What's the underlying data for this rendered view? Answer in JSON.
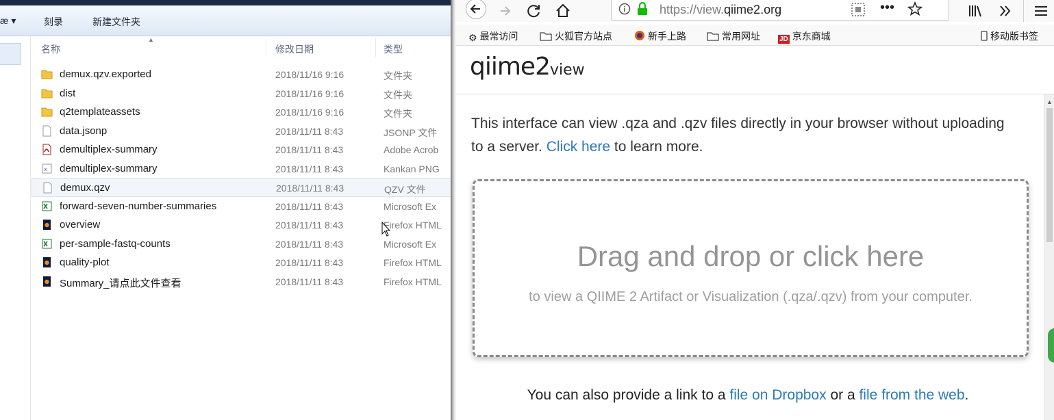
{
  "explorer": {
    "toolbar": {
      "organize": "æ ▾",
      "burn": "刻录",
      "new_folder": "新建文件夹"
    },
    "columns": {
      "name": "名称",
      "date": "修改日期",
      "type": "类型"
    },
    "files": [
      {
        "name": "demux.qzv.exported",
        "date": "2018/11/16 9:16",
        "type": "文件夹",
        "icon": "folder-icon"
      },
      {
        "name": "dist",
        "date": "2018/11/16 9:16",
        "type": "文件夹",
        "icon": "folder-icon"
      },
      {
        "name": "q2templateassets",
        "date": "2018/11/16 9:16",
        "type": "文件夹",
        "icon": "folder-icon"
      },
      {
        "name": "data.jsonp",
        "date": "2018/11/11 8:43",
        "type": "JSONP 文件",
        "icon": "document-icon"
      },
      {
        "name": "demultiplex-summary",
        "date": "2018/11/11 8:43",
        "type": "Adobe Acrob",
        "icon": "pdf-icon"
      },
      {
        "name": "demultiplex-summary",
        "date": "2018/11/11 8:43",
        "type": "Kankan PNG",
        "icon": "png-icon"
      },
      {
        "name": "demux.qzv",
        "date": "2018/11/11 8:43",
        "type": "QZV 文件",
        "icon": "document-icon"
      },
      {
        "name": "forward-seven-number-summaries",
        "date": "2018/11/11 8:43",
        "type": "Microsoft Ex",
        "icon": "excel-icon"
      },
      {
        "name": "overview",
        "date": "2018/11/11 8:43",
        "type": "Firefox HTML",
        "icon": "html-icon"
      },
      {
        "name": "per-sample-fastq-counts",
        "date": "2018/11/11 8:43",
        "type": "Microsoft Ex",
        "icon": "excel-icon"
      },
      {
        "name": "quality-plot",
        "date": "2018/11/11 8:43",
        "type": "Firefox HTML",
        "icon": "html-icon"
      },
      {
        "name": "Summary_请点此文件查看",
        "date": "2018/11/11 8:43",
        "type": "Firefox HTML",
        "icon": "html-icon"
      }
    ]
  },
  "browser": {
    "url_prefix": "https://view.",
    "url_domain": "qiime2.org",
    "bookmarks": [
      "最常访问",
      "火狐官方站点",
      "新手上路",
      "常用网址",
      "京东商城",
      "移动版书签"
    ],
    "logo": {
      "main": "qiime2",
      "sub": "view"
    },
    "intro_before": "This interface can view .qza and .qzv files directly in your browser without uploading to a server. ",
    "intro_link": "Click here",
    "intro_after": " to learn more.",
    "dropzone_title": "Drag and drop or click here",
    "dropzone_sub": "to view a QIIME 2 Artifact or Visualization (.qza/.qzv) from your computer.",
    "alt_before": "You can also provide a link to a ",
    "alt_link1": "file on Dropbox",
    "alt_mid": " or a ",
    "alt_link2": "file from the web",
    "alt_after": "."
  }
}
